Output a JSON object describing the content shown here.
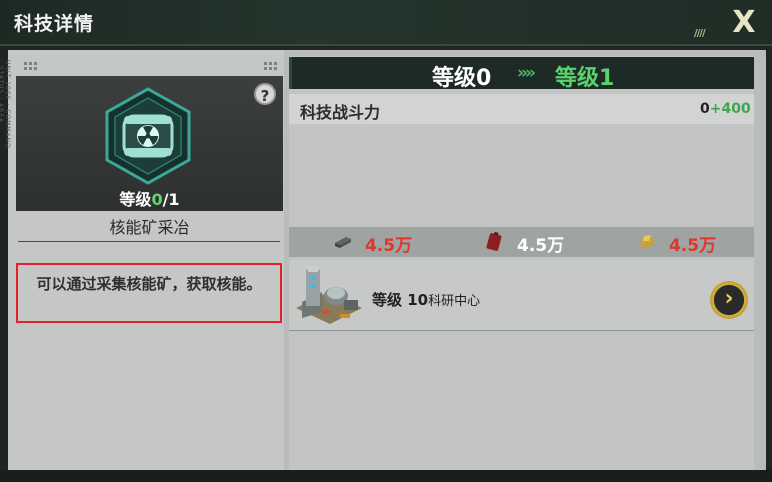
{
  "header": {
    "title": "科技详情",
    "stripes": "////",
    "close": "X"
  },
  "left": {
    "side_text": "UNIT 1000 · COMMAND · STATUS · AREA",
    "help": "?",
    "level_prefix": "等级",
    "level_current": "0",
    "level_max": "/1",
    "tech_name": "核能矿采冶",
    "description": "可以通过采集核能矿，获取核能。"
  },
  "right": {
    "level_from": "等级0",
    "level_arrow": "»»",
    "level_to": "等级1",
    "power_label": "科技战斗力",
    "power_base": "0",
    "power_plus": "+400",
    "costs": [
      {
        "icon": "steel-icon",
        "value": "4.5万",
        "color": "#e0362c"
      },
      {
        "icon": "fuel-can-icon",
        "value": "4.5万",
        "color": "#ffffff"
      },
      {
        "icon": "ore-icon",
        "value": "4.5万",
        "color": "#e0362c"
      }
    ],
    "requirement_level": "等级 10",
    "requirement_building": "科研中心",
    "go": "›"
  },
  "colors": {
    "accent_green": "#58d46a",
    "warning_red": "#e5202a",
    "gold": "#d4b23a"
  }
}
